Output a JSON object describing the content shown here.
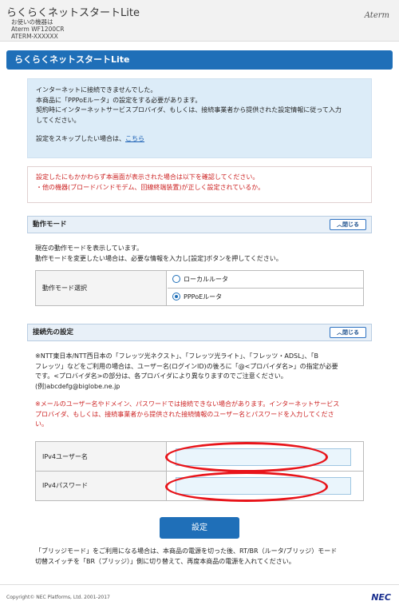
{
  "header": {
    "app_title": "らくらくネットスタートLite",
    "device_lines": [
      "お使いの機器は",
      "Aterm WF1200CR",
      "ATERM-XXXXXX"
    ],
    "brand": "Aterm"
  },
  "page_title": "らくらくネットスタートLite",
  "info": {
    "lines": [
      "インターネットに接続できませんでした。",
      "本商品に「PPPoEルータ」の設定をする必要があります。",
      "契約時にインターネットサービスプロバイダ、もしくは、接続事業者から提供された設定情報に従って入力",
      "してください。"
    ],
    "skip_text": "設定をスキップしたい場合は、",
    "skip_link": "こちら"
  },
  "warning": {
    "lines": [
      "設定したにもかかわらず本画面が表示された場合は以下を確認してください。",
      "・他の機器(ブロードバンドモデム、回線終端装置)が正しく設定されているか。"
    ]
  },
  "mode_section": {
    "title": "動作モード",
    "close_label": "閉じる",
    "desc_lines": [
      "現在の動作モードを表示しています。",
      "動作モードを変更したい場合は、必要な情報を入力し[設定]ボタンを押してください。"
    ],
    "field_label": "動作モード選択",
    "options": [
      "ローカルルータ",
      "PPPoEルータ"
    ],
    "selected": "PPPoEルータ"
  },
  "conn_section": {
    "title": "接続先の設定",
    "close_label": "閉じる",
    "desc_lines": [
      "※NTT東日本/NTT西日本の「フレッツ光ネクスト」、「フレッツ光ライト」、「フレッツ・ADSL」、「B",
      "フレッツ」などをご利用の場合は、ユーザー名(ログインID)の後ろに「@<プロバイダ名>」の指定が必要",
      "です。<プロバイダ名>の部分は、各プロバイダにより異なりますのでご注意ください。",
      "(例)abcdefg@biglobe.ne.jp"
    ],
    "note_lines": [
      "※メールのユーザー名やドメイン、パスワードでは接続できない場合があります。インターネットサービス",
      "プロバイダ、もしくは、接続事業者から提供された接続情報のユーザー名とパスワードを入力してくださ",
      "い。"
    ],
    "username_label": "IPv4ユーザー名",
    "username_value": "",
    "password_label": "IPv4パスワード",
    "password_value": ""
  },
  "submit_label": "設定",
  "bridge_note_lines": [
    "「ブリッジモード」をご利用になる場合は、本商品の電源を切った後、RT/BR（ルータ/ブリッジ）モード",
    "切替スイッチを「BR（ブリッジ）」側に切り替えて、再度本商品の電源を入れてください。"
  ],
  "footer": {
    "copyright": "Copyright© NEC Platforms, Ltd. 2001-2017",
    "logo": "NEC"
  },
  "colors": {
    "accent": "#1f6fb8",
    "warning_text": "#cc2222",
    "annotation": "#e8141a",
    "info_bg": "#dcecf8"
  }
}
